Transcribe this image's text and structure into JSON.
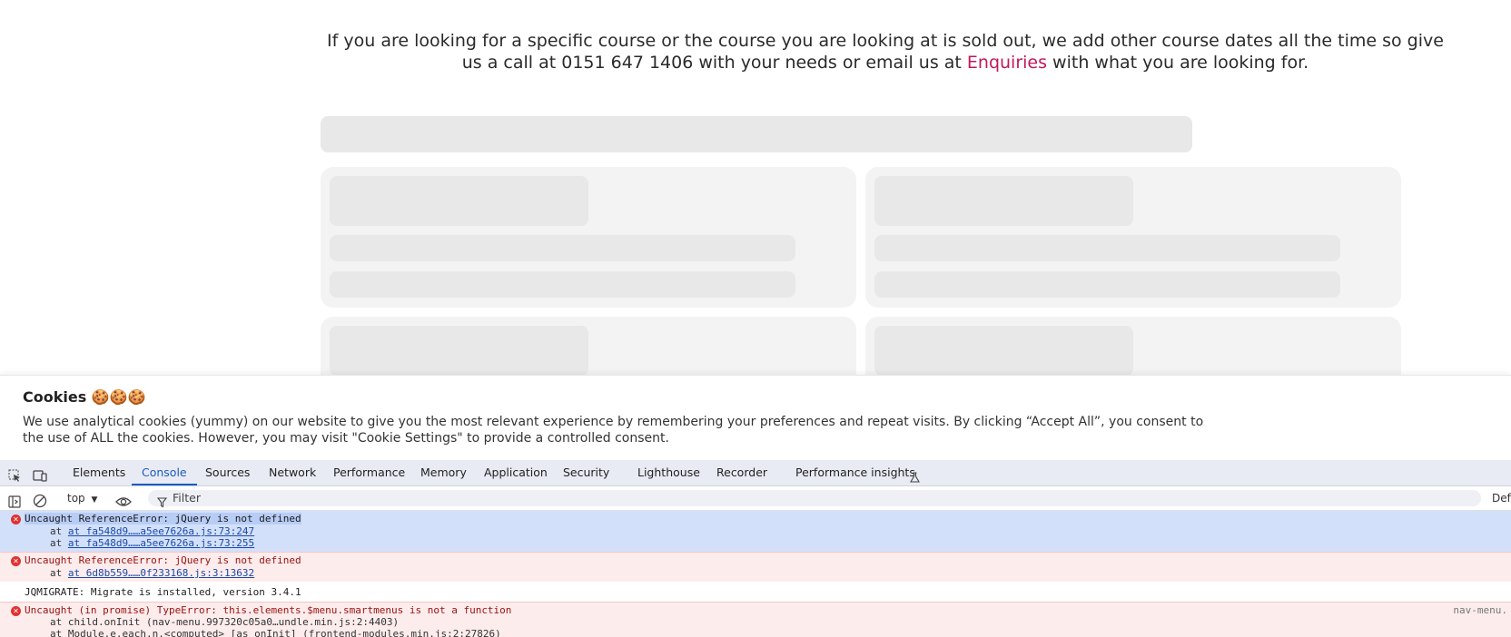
{
  "page": {
    "intro_before": "If you are looking for a specific course or the course you are looking at is sold out, we add other course dates all the time so give us a call at 0151 647 1406 with your needs or email us at ",
    "intro_link": "Enquiries",
    "intro_after": " with what you are looking for."
  },
  "cookie": {
    "title": "Cookies 🍪🍪🍪",
    "text": "We use analytical cookies (yummy) on our website to give you the most relevant experience by remembering your preferences and repeat visits. By clicking “Accept All”, you consent to the use of ALL the cookies. However, you may visit \"Cookie Settings\" to provide a controlled consent."
  },
  "devtools": {
    "tabs": [
      "Elements",
      "Console",
      "Sources",
      "Network",
      "Performance",
      "Memory",
      "Application",
      "Security",
      "Lighthouse",
      "Recorder",
      "Performance insights"
    ],
    "active_tab": "Console",
    "context": "top",
    "filter_placeholder": "Filter",
    "levels_label": "Def",
    "messages": [
      {
        "type": "error",
        "text": "Uncaught ReferenceError: jQuery is not defined",
        "stack": [
          "at fa548d9……a5ee7626a.js:73:247",
          "at fa548d9……a5ee7626a.js:73:255"
        ]
      },
      {
        "type": "error",
        "text": "Uncaught ReferenceError: jQuery is not defined",
        "stack": [
          "at 6d8b559……0f233168.js:3:13632"
        ]
      },
      {
        "type": "info",
        "text": "JQMIGRATE: Migrate is installed, version 3.4.1"
      },
      {
        "type": "error",
        "text": "Uncaught (in promise) TypeError: this.elements.$menu.smartmenus is not a function",
        "source": "nav-menu.",
        "stack": [
          "at child.onInit (nav-menu.997320c05a0…undle.min.js:2:4403)",
          "at Module.e.each.n.<computed> [as onInit] (frontend-modules.min.js:2:27826)"
        ]
      }
    ]
  },
  "colors": {
    "accent_link": "#c2185b",
    "devtools_active": "#1a5bc4",
    "error_bg": "#fdecec"
  }
}
